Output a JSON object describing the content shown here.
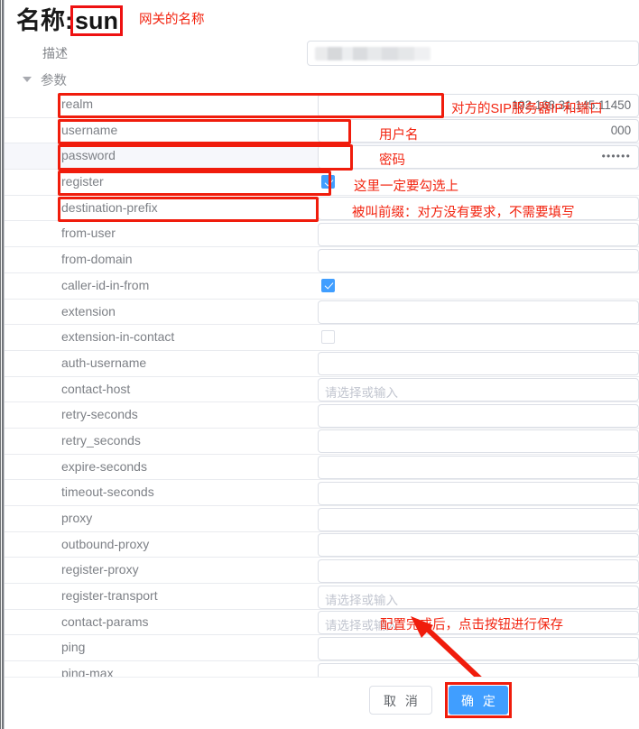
{
  "header": {
    "title_label": "名称:",
    "title_value": "sun",
    "title_note": "网关的名称",
    "description_label": "描述",
    "description_value": "",
    "group_label": "参数"
  },
  "placeholders": {
    "select_or_input": "请选择或输入"
  },
  "rows": [
    {
      "label": "realm",
      "type": "text",
      "value": "192.168.31.145:11450",
      "placeholder": "",
      "highlighted": false
    },
    {
      "label": "username",
      "type": "text",
      "value": "000",
      "placeholder": "",
      "highlighted": false
    },
    {
      "label": "password",
      "type": "password",
      "value": "••••••",
      "placeholder": "",
      "highlighted": true
    },
    {
      "label": "register",
      "type": "checkbox",
      "checked": true,
      "placeholder": "",
      "highlighted": false
    },
    {
      "label": "destination-prefix",
      "type": "text",
      "value": "",
      "placeholder": "",
      "highlighted": false
    },
    {
      "label": "from-user",
      "type": "text",
      "value": "",
      "placeholder": "",
      "highlighted": false
    },
    {
      "label": "from-domain",
      "type": "text",
      "value": "",
      "placeholder": "",
      "highlighted": false
    },
    {
      "label": "caller-id-in-from",
      "type": "checkbox",
      "checked": true,
      "placeholder": "",
      "highlighted": false
    },
    {
      "label": "extension",
      "type": "text",
      "value": "",
      "placeholder": "",
      "highlighted": false
    },
    {
      "label": "extension-in-contact",
      "type": "checkbox",
      "checked": false,
      "placeholder": "",
      "highlighted": false
    },
    {
      "label": "auth-username",
      "type": "text",
      "value": "",
      "placeholder": "",
      "highlighted": false
    },
    {
      "label": "contact-host",
      "type": "select",
      "value": "",
      "placeholder": "请选择或输入",
      "highlighted": false
    },
    {
      "label": "retry-seconds",
      "type": "text",
      "value": "",
      "placeholder": "",
      "highlighted": false
    },
    {
      "label": "retry_seconds",
      "type": "text",
      "value": "",
      "placeholder": "",
      "highlighted": false
    },
    {
      "label": "expire-seconds",
      "type": "text",
      "value": "",
      "placeholder": "",
      "highlighted": false
    },
    {
      "label": "timeout-seconds",
      "type": "text",
      "value": "",
      "placeholder": "",
      "highlighted": false
    },
    {
      "label": "proxy",
      "type": "text",
      "value": "",
      "placeholder": "",
      "highlighted": false
    },
    {
      "label": "outbound-proxy",
      "type": "text",
      "value": "",
      "placeholder": "",
      "highlighted": false
    },
    {
      "label": "register-proxy",
      "type": "text",
      "value": "",
      "placeholder": "",
      "highlighted": false
    },
    {
      "label": "register-transport",
      "type": "select",
      "value": "",
      "placeholder": "请选择或输入",
      "highlighted": false
    },
    {
      "label": "contact-params",
      "type": "select",
      "value": "",
      "placeholder": "请选择或输入",
      "highlighted": false
    },
    {
      "label": "ping",
      "type": "text",
      "value": "",
      "placeholder": "",
      "highlighted": false
    },
    {
      "label": "ping-max",
      "type": "text",
      "value": "",
      "placeholder": "",
      "highlighted": false
    }
  ],
  "annotations": {
    "realm_note": "对方的SIP服务器IP和端口",
    "username_note": "用户名",
    "password_note": "密码",
    "register_note": "这里一定要勾选上",
    "destination_prefix_note": "被叫前缀：对方没有要求，不需要填写",
    "save_note": "配置完成后，点击按钮进行保存"
  },
  "footer": {
    "cancel_label": "取 消",
    "confirm_label": "确 定"
  },
  "colors": {
    "annotation_red": "#f01c0c",
    "primary_blue": "#409eff",
    "label_gray": "#7d8086",
    "border_gray": "#dcdfe6"
  }
}
